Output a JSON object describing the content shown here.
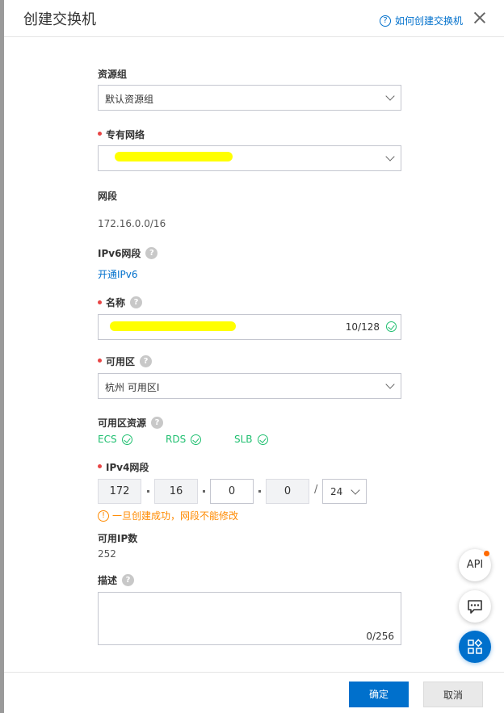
{
  "header": {
    "title": "创建交换机",
    "help_icon": "?",
    "help_text": "如何创建交换机",
    "close_icon": "close-icon"
  },
  "form": {
    "resource_group": {
      "label": "资源组",
      "value": "默认资源组"
    },
    "vpc": {
      "label": "专有网络"
    },
    "network_segment": {
      "label": "网段",
      "value": "172.16.0.0/16"
    },
    "ipv6": {
      "label": "IPv6网段",
      "link": "开通IPv6"
    },
    "name": {
      "label": "名称",
      "counter": "10/128"
    },
    "zone": {
      "label": "可用区",
      "value": "杭州 可用区I"
    },
    "zone_resources": {
      "label": "可用区资源",
      "items": [
        "ECS",
        "RDS",
        "SLB"
      ]
    },
    "ipv4": {
      "label": "IPv4网段",
      "octets": [
        "172",
        "16",
        "0",
        "0"
      ],
      "slash": "/",
      "mask": "24",
      "warning_icon": "!",
      "warning": "一旦创建成功，网段不能修改"
    },
    "available_ips": {
      "label": "可用IP数",
      "value": "252"
    },
    "description": {
      "label": "描述",
      "counter": "0/256"
    },
    "help_mark": "?"
  },
  "footer": {
    "confirm": "确定",
    "cancel": "取消"
  },
  "floating": {
    "api": "API"
  },
  "colors": {
    "primary": "#0070cc",
    "success": "#1ebf6f",
    "warning": "#ff8a00",
    "required": "#e84545"
  }
}
